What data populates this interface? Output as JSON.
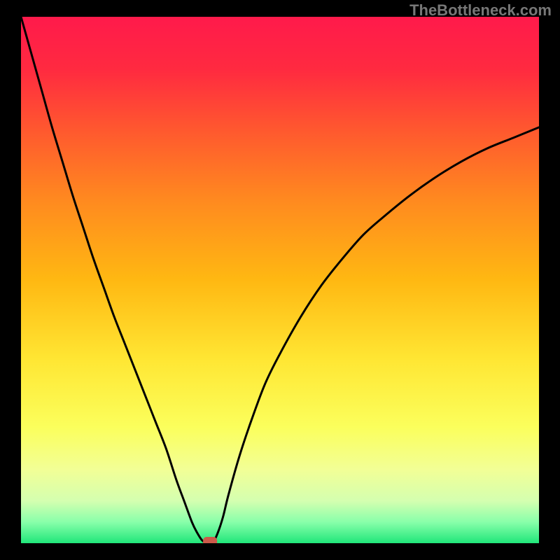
{
  "watermark": "TheBottleneck.com",
  "chart_data": {
    "type": "line",
    "title": "",
    "xlabel": "",
    "ylabel": "",
    "xlim": [
      0,
      100
    ],
    "ylim": [
      0,
      100
    ],
    "grid": false,
    "legend": false,
    "series": [
      {
        "name": "bottleneck-curve",
        "x": [
          0,
          2,
          4,
          6,
          8,
          10,
          12,
          14,
          16,
          18,
          20,
          22,
          24,
          26,
          28,
          30,
          31.5,
          33,
          34,
          35,
          36,
          37,
          38,
          39,
          40,
          42,
          44,
          47,
          50,
          54,
          58,
          62,
          66,
          70,
          75,
          80,
          85,
          90,
          95,
          100
        ],
        "y": [
          100,
          93,
          86,
          79,
          72.5,
          66,
          60,
          54,
          48.5,
          43,
          38,
          33,
          28,
          23,
          18,
          12,
          8,
          4,
          2,
          0.5,
          0,
          0,
          2,
          5,
          9,
          16,
          22,
          30,
          36,
          43,
          49,
          54,
          58.5,
          62,
          66,
          69.5,
          72.5,
          75,
          77,
          79
        ]
      }
    ],
    "marker": {
      "x": 36.5,
      "y": 0,
      "color": "#cc5a4a",
      "shape": "rounded-square"
    },
    "gradient_stops": [
      {
        "offset": 0.0,
        "color": "#ff1a4b"
      },
      {
        "offset": 0.1,
        "color": "#ff2a40"
      },
      {
        "offset": 0.22,
        "color": "#ff5a2e"
      },
      {
        "offset": 0.35,
        "color": "#ff8a1f"
      },
      {
        "offset": 0.5,
        "color": "#ffb812"
      },
      {
        "offset": 0.65,
        "color": "#ffe633"
      },
      {
        "offset": 0.78,
        "color": "#fbff5c"
      },
      {
        "offset": 0.86,
        "color": "#f2ff96"
      },
      {
        "offset": 0.92,
        "color": "#d4ffb0"
      },
      {
        "offset": 0.96,
        "color": "#88ffaa"
      },
      {
        "offset": 1.0,
        "color": "#20e67a"
      }
    ]
  }
}
